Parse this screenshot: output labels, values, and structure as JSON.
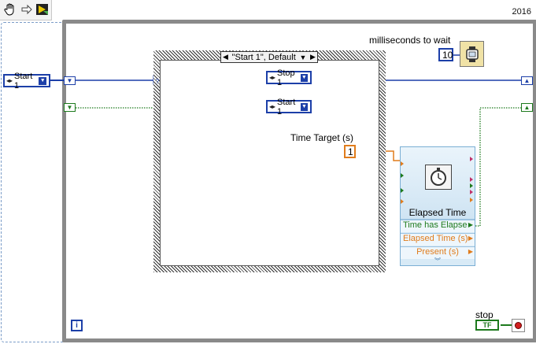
{
  "toolbar": {
    "version": "2016",
    "icons": [
      "hand-icon",
      "arrow-icon",
      "run-highlight-icon"
    ]
  },
  "case_structure": {
    "selector_label": "\"Start 1\", Default"
  },
  "enums": {
    "init_state": "Start 1",
    "stop1": "Stop 1",
    "start1": "Start 1"
  },
  "constants": {
    "wait_ms_label": "milliseconds to wait",
    "wait_ms_value": "10",
    "time_target_label": "Time Target (s)",
    "time_target_value": "1"
  },
  "elapsed_time": {
    "title": "Elapsed Time",
    "outputs": [
      "Time has Elapse",
      "Elapsed Time (s)",
      "Present (s)"
    ]
  },
  "stop": {
    "label": "stop",
    "tf": "TF"
  },
  "iteration_label": "i",
  "colors": {
    "enum_wire": "#1c3fa8",
    "bool_wire": "#1d7a1d",
    "dbl_wire": "#e07c1c"
  }
}
